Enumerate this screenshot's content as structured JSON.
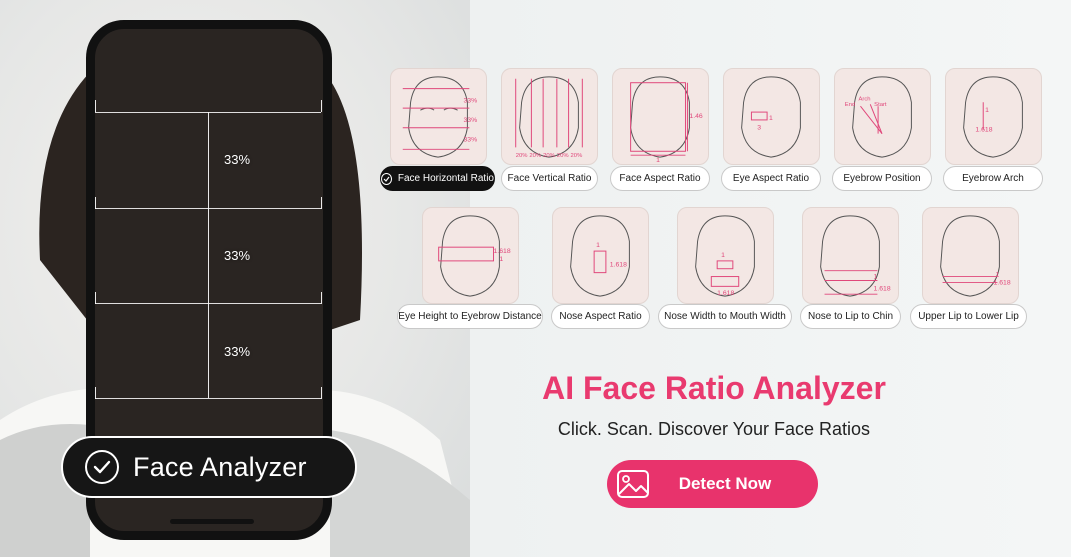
{
  "hero": {
    "badge_label": "Face Analyzer",
    "percent_labels": [
      "33%",
      "33%",
      "33%"
    ]
  },
  "ratios": {
    "row1": [
      {
        "label": "Face Horizontal Ratio",
        "selected": true,
        "overlay": [
          "33%",
          "33%",
          "33%"
        ]
      },
      {
        "label": "Face Vertical Ratio",
        "selected": false,
        "overlay": [
          "20%",
          "20%",
          "20%",
          "20%",
          "20%"
        ]
      },
      {
        "label": "Face Aspect Ratio",
        "selected": false,
        "overlay": [
          "1.46",
          "1"
        ]
      },
      {
        "label": "Eye Aspect Ratio",
        "selected": false,
        "overlay": [
          "1",
          "3"
        ]
      },
      {
        "label": "Eyebrow Position",
        "selected": false,
        "overlay": [
          "End",
          "Arch",
          "Start"
        ]
      },
      {
        "label": "Eyebrow Arch",
        "selected": false,
        "overlay": [
          "1",
          "1.618"
        ]
      }
    ],
    "row2": [
      {
        "label": "Eye Height to Eyebrow Distance",
        "selected": false,
        "overlay": [
          "1.618",
          "1"
        ]
      },
      {
        "label": "Nose Aspect Ratio",
        "selected": false,
        "overlay": [
          "1",
          "1.618"
        ]
      },
      {
        "label": "Nose Width to Mouth Width",
        "selected": false,
        "overlay": [
          "1",
          "1.618"
        ]
      },
      {
        "label": "Nose to Lip to Chin",
        "selected": false,
        "overlay": [
          "1",
          "1.618"
        ]
      },
      {
        "label": "Upper Lip to Lower Lip",
        "selected": false,
        "overlay": [
          "1",
          "1.618"
        ]
      }
    ]
  },
  "promo": {
    "title": "AI Face Ratio Analyzer",
    "subtitle": "Click. Scan. Discover Your Face Ratios",
    "cta_label": "Detect Now"
  },
  "colors": {
    "accent": "#e8336c",
    "headline": "#e93a6f",
    "card_bg": "#f3e7e4",
    "overlay_lines": "#e0477a"
  },
  "icons": {
    "badge": "check-circle-icon",
    "pill_selected": "check-circle-icon",
    "cta": "image-icon"
  }
}
